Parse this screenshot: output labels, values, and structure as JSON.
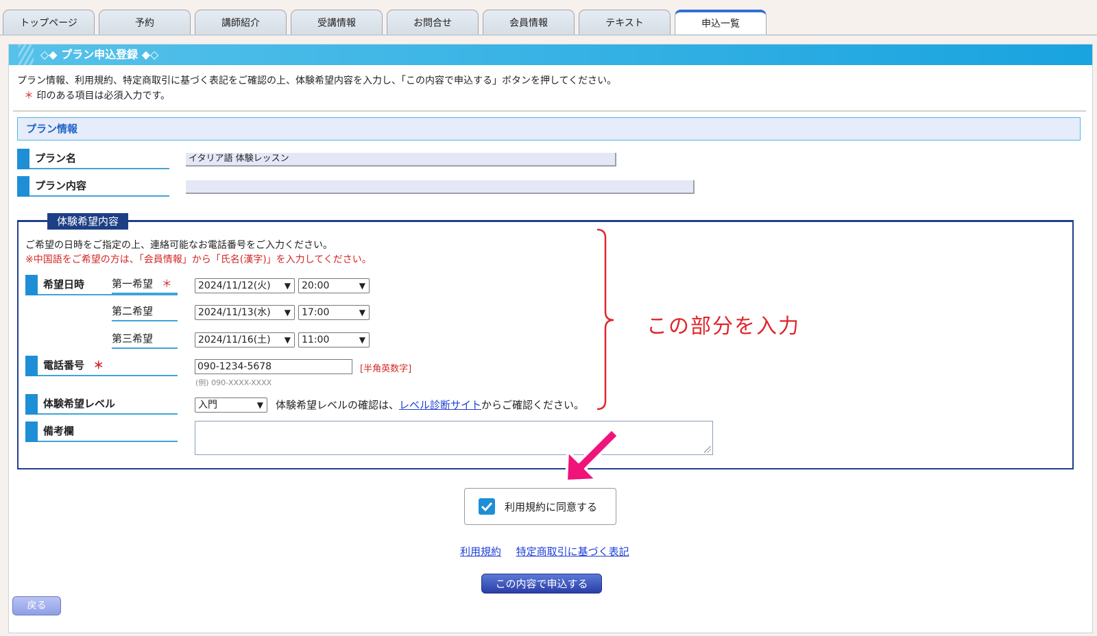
{
  "tabs": [
    {
      "label": "トップページ"
    },
    {
      "label": "予約"
    },
    {
      "label": "講師紹介"
    },
    {
      "label": "受講情報"
    },
    {
      "label": "お問合せ"
    },
    {
      "label": "会員情報"
    },
    {
      "label": "テキスト"
    },
    {
      "label": "申込一覧"
    }
  ],
  "active_tab": "申込一覧",
  "page": {
    "title": "◇◆ プラン申込登録 ◆◇",
    "intro": "プラン情報、利用規約、特定商取引に基づく表記をご確認の上、体験希望内容を入力し、「この内容で申込する」ボタンを押してください。",
    "required_star": "＊",
    "required_note": "印のある項目は必須入力です。"
  },
  "plan_info": {
    "heading": "プラン情報",
    "plan_name_label": "プラン名",
    "plan_name_value": "イタリア語 体験レッスン",
    "plan_content_label": "プラン内容",
    "plan_content_value": ""
  },
  "trial": {
    "legend": "体験希望内容",
    "desc": "ご希望の日時をご指定の上、連絡可能なお電話番号をご入力ください。",
    "desc_red": "※中国語をご希望の方は、「会員情報」から「氏名(漢字)」を入力してください。",
    "datetime_label": "希望日時",
    "star": "＊",
    "choices": [
      {
        "label": "第一希望",
        "date": "2024/11/12(火)",
        "time": "20:00"
      },
      {
        "label": "第二希望",
        "date": "2024/11/13(水)",
        "time": "17:00"
      },
      {
        "label": "第三希望",
        "date": "2024/11/16(土)",
        "time": "11:00"
      }
    ],
    "phone_label": "電話番号",
    "phone_value": "090-1234-5678",
    "phone_hint": "[半角英数字]",
    "phone_example": "(例) 090-XXXX-XXXX",
    "level_label": "体験希望レベル",
    "level_value": "入門",
    "level_text_before": "体験希望レベルの確認は、",
    "level_link": "レベル診断サイト",
    "level_text_after": "からご確認ください。",
    "notes_label": "備考欄",
    "notes_value": ""
  },
  "annotation": "この部分を入力",
  "agree": {
    "label": "利用規約に同意する",
    "checked": true
  },
  "links": {
    "terms": "利用規約",
    "law": "特定商取引に基づく表記"
  },
  "buttons": {
    "submit": "この内容で申込する",
    "back": "戻る"
  },
  "colors": {
    "header": "#19a3df",
    "legend": "#1c3f86",
    "accent": "#1e8fd6",
    "annotation": "#e0262b",
    "arrow": "#f0137a"
  }
}
